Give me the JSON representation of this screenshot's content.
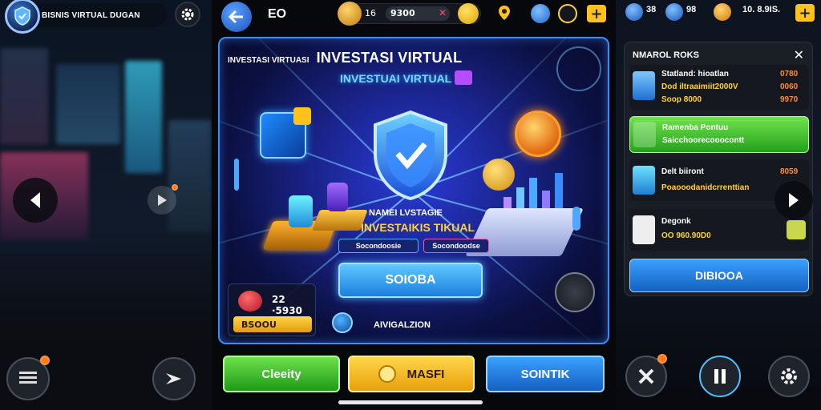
{
  "left": {
    "title": "BISNIS VIRTUAL DUGAN",
    "icons": {
      "logo": "shield-icon",
      "settings": "gear-icon",
      "prev": "arrow-left-icon",
      "next": "play-icon",
      "menu": "list-icon",
      "share": "share-icon"
    }
  },
  "middle": {
    "level": "ЕO",
    "coins": {
      "small": "16",
      "value": "9300",
      "x_mark": "✕"
    },
    "card": {
      "title_small": "INVESTASI VIRTUASI",
      "title_big": "INVESTASI VIRTUAL",
      "subtitle": "INVESTUAI VIRTUAL",
      "label1": "NAMEI LVSTAGIE",
      "label2": "INVESTAIKIS TIKUAL",
      "chip_a": "Socondoosie",
      "chip_b": "Socondoodse",
      "main_button": "SOIOBA",
      "stat_value": "22 ·5930",
      "stat_gold": "BSOOU",
      "footer_text": "AIVIGALZION"
    },
    "buttons": {
      "green": "Cleeity",
      "yellow": "MASFI",
      "blue": "SOINTIK"
    }
  },
  "right": {
    "stats": {
      "a": "38",
      "b": "98",
      "c": "10. 8.9IS."
    },
    "panel_title": "NMAROL ROKS",
    "item1": {
      "line1": "Statland: hioatlan",
      "line1_val": "0780",
      "line2": "Dod iltraaimiit2000V",
      "line2_val": "0060",
      "line3": "Soop 8000",
      "line3_val": "9970"
    },
    "item2": {
      "line1": "Ramenba Pontuu",
      "line2": "Saicchoorecooocontt"
    },
    "item3": {
      "line1": "Delt biiront",
      "line1_val": "8059",
      "line2": "Poaooodanidcrrenttian"
    },
    "item4": {
      "line1": "Degonk",
      "line2": "OO 960.90D0"
    },
    "item5": "DIBIOOA"
  },
  "colors": {
    "accent_blue": "#3d8bff",
    "gold": "#ffc21a",
    "green": "#2fb52a",
    "card_bg": "#1b2590"
  }
}
